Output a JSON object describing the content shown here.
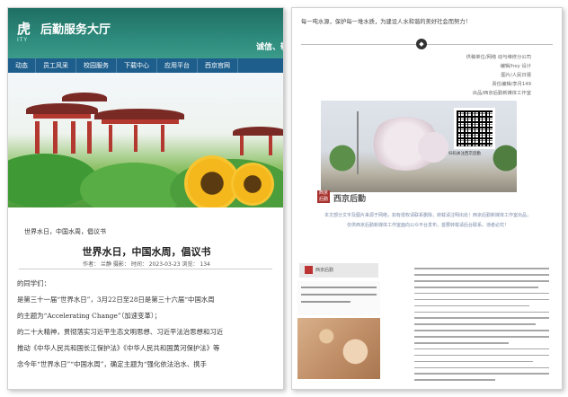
{
  "left": {
    "logo": "虎",
    "logo_sub": "ITY",
    "site_title": "后勤服务大厅",
    "slogan": "诚信、敬",
    "nav": [
      "动态",
      "员工风采",
      "校园服务",
      "下载中心",
      "应用平台",
      "西京官网"
    ],
    "image_caption": "世界水日，中国水周，倡议书",
    "article_title": "世界水日，中国水周，倡议书",
    "meta": "作者：  兰静  摄影：  时间：  2023-03-23  浏览：  134",
    "paragraphs": [
      "的同学们：",
      "是第三十一届“世界水日”，3月22日至28日是第三十六届“中国水周",
      "的主题为“Accelerating Change”（加速变革）；",
      "的二十大精神，贯彻落实习近平生态文明思想、习近平法治思想和习近",
      "推动《中华人民共和国长江保护法》《中华人民共和国黄河保护法》等",
      "念今年“世界水日”“中国水周”，确定主题为“强化依法治水、携手"
    ]
  },
  "right": {
    "top_line": "每一吨水源，保护每一堆水质，为建设人水和谐的美好社会而努力！",
    "divider_icon": "◆",
    "credits": [
      "供稿单位/网络 动与维修分公司",
      "编辑/hey 设计",
      "图片/人民日报",
      "责任编辑/李月149",
      "出品/西京后勤新媒体工作室"
    ],
    "qr_label": "扫码关注西京后勤",
    "logo_text": "西京后勤",
    "notice_lines": [
      "本文部分文字及图片来源于网络，如有侵权请联系删除，转载请注明出处！西京后勤新媒体工作室出品，",
      "仅供西京后勤新媒体工作室面向公众平台发布，首要转载请后台联系。违者必究！"
    ],
    "thumb_header": "西京后勤"
  },
  "colors": {
    "header_green": "#2d8a7c",
    "nav_blue": "#1e5e8c",
    "brand_red": "#a8322d"
  }
}
